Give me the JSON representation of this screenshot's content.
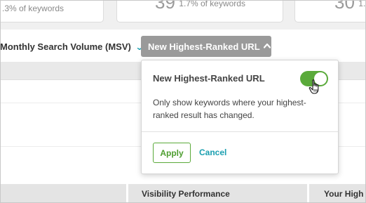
{
  "stat_cards": [
    {
      "big_value": "",
      "text": ".3% of keywords"
    },
    {
      "big_value": "39",
      "text": "1.7% of keywords"
    },
    {
      "big_value": "30",
      "text": "1.3"
    }
  ],
  "filters": {
    "msv_label": "Monthly Search Volume (MSV)",
    "msv_icon": "chevron-down-icon",
    "url_button_label": "New Highest-Ranked URL",
    "url_button_icon": "chevron-up-icon"
  },
  "popover": {
    "title": "New Highest-Ranked URL",
    "toggle_on": true,
    "description": "Only show keywords where your highest-ranked result has changed.",
    "apply_label": "Apply",
    "cancel_label": "Cancel"
  },
  "table": {
    "columns": [
      "",
      "Visibility Performance",
      "Your High"
    ]
  },
  "colors": {
    "accent_green": "#5aaa3a",
    "accent_teal": "#1a9fb0",
    "button_gray": "#9a9a9a"
  }
}
